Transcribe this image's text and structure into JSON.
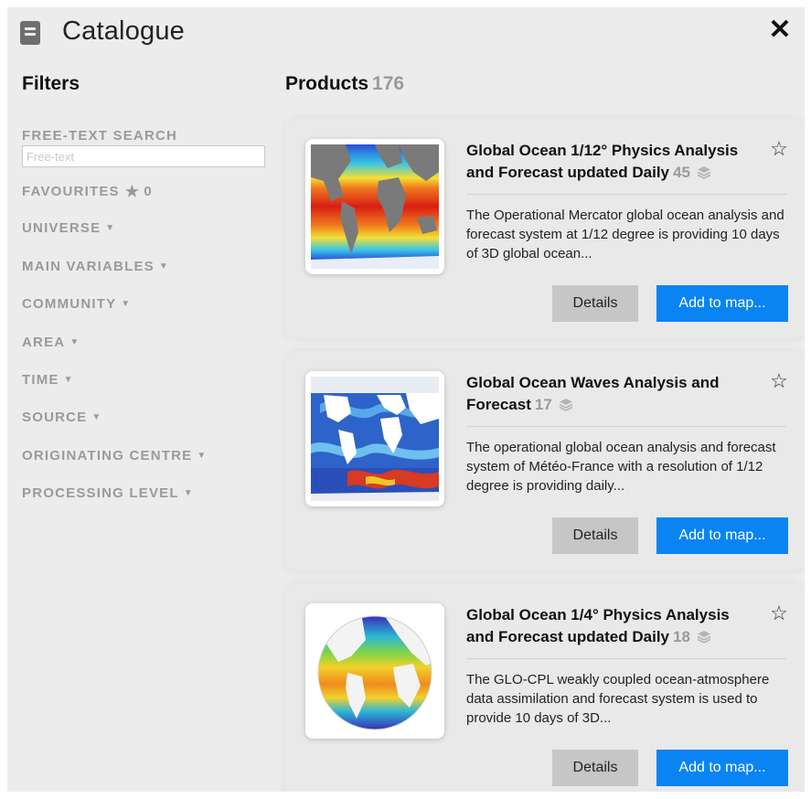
{
  "header": {
    "title": "Catalogue",
    "close_label": "✕"
  },
  "filters": {
    "title": "Filters",
    "search_label": "FREE-TEXT SEARCH",
    "search_placeholder": "Free-text",
    "search_value": "",
    "favourites_label": "FAVOURITES",
    "favourites_count": "0",
    "items": [
      {
        "label": "UNIVERSE"
      },
      {
        "label": "MAIN VARIABLES"
      },
      {
        "label": "COMMUNITY"
      },
      {
        "label": "AREA"
      },
      {
        "label": "TIME"
      },
      {
        "label": "SOURCE"
      },
      {
        "label": "ORIGINATING CENTRE"
      },
      {
        "label": "PROCESSING LEVEL"
      }
    ]
  },
  "products": {
    "title": "Products",
    "count": "176",
    "details_label": "Details",
    "add_label": "Add to map...",
    "items": [
      {
        "title": "Global Ocean 1/12° Physics Analysis and Forecast updated Daily",
        "layers": "45",
        "description": "The Operational Mercator global ocean analysis and forecast system at 1/12 degree is providing 10 days of 3D global ocean...",
        "thumbnail": "ocean-temperature-map"
      },
      {
        "title": "Global Ocean Waves Analysis and Forecast",
        "layers": "17",
        "description": "The operational global ocean analysis and forecast system of Météo-France with a resolution of 1/12 degree is providing daily...",
        "thumbnail": "ocean-waves-map"
      },
      {
        "title": "Global Ocean 1/4° Physics Analysis and Forecast updated Daily",
        "layers": "18",
        "description": "The GLO-CPL weakly coupled ocean-atmosphere data assimilation and forecast system is used to provide 10 days of 3D...",
        "thumbnail": "ocean-globe"
      }
    ]
  },
  "colors": {
    "accent": "#0a84f2",
    "panel": "#ececec",
    "muted": "#9a9a9a"
  }
}
